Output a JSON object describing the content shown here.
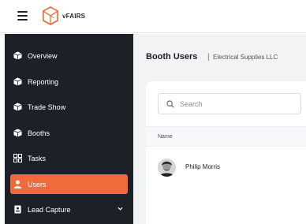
{
  "brand": {
    "name": "vFAIRS",
    "accent": "#f06a3a"
  },
  "sidebar": {
    "items": [
      {
        "label": "Overview",
        "icon": "cube-icon",
        "active": false
      },
      {
        "label": "Reporting",
        "icon": "cube-icon",
        "active": false
      },
      {
        "label": "Trade Show",
        "icon": "cube-icon",
        "active": false
      },
      {
        "label": "Booths",
        "icon": "cube-icon",
        "active": false
      },
      {
        "label": "Tasks",
        "icon": "grid-icon",
        "active": false
      },
      {
        "label": "Users",
        "icon": "user-icon",
        "active": true
      },
      {
        "label": "Lead Capture",
        "icon": "id-card-icon",
        "active": false,
        "expandable": true
      }
    ]
  },
  "header": {
    "title": "Booth Users",
    "separator": "|",
    "subtitle": "Electrical Supplies LLC"
  },
  "search": {
    "placeholder": "Search",
    "value": ""
  },
  "table": {
    "columns": [
      "Name"
    ],
    "rows": [
      {
        "name": "Philip Morris"
      }
    ]
  }
}
